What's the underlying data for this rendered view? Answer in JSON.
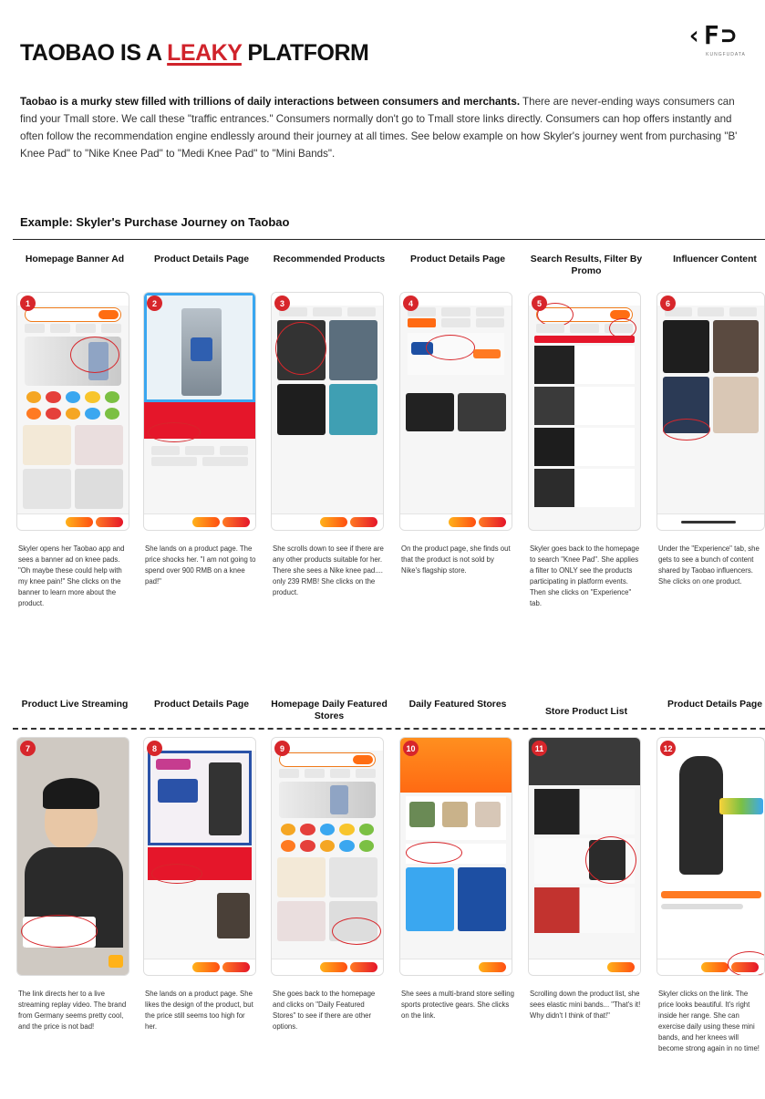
{
  "header": {
    "title_prefix": "TAOBAO IS A ",
    "title_highlight": "LEAKY",
    "title_suffix": " PLATFORM",
    "logo_mark": "‹F⊃",
    "logo_tag": "KUNGFUDATA"
  },
  "intro": {
    "bold": "Taobao is a murky stew filled with trillions of daily interactions between consumers and merchants.",
    "rest": " There are never-ending ways consumers can find your Tmall store. We call these \"traffic entrances.\" Consumers normally don't go to Tmall store links directly. Consumers can hop offers instantly and often follow the recommendation engine endlessly around their journey at all times. See below example on how Skyler's journey went from purchasing \"B' Knee Pad\" to \"Nike Knee Pad\" to \"Medi Knee Pad\" to \"Mini Bands\"."
  },
  "section_heading": "Example: Skyler's Purchase Journey on Taobao",
  "steps": [
    {
      "num": "1",
      "title": "Homepage Banner Ad",
      "caption": "Skyler opens her Taobao app and sees a banner ad on knee pads. \"Oh maybe these could help with my knee pain!\" She clicks on the banner to learn more about the product."
    },
    {
      "num": "2",
      "title": "Product Details Page",
      "caption": "She lands on a product page. The price shocks her. \"I am not going to spend over 900 RMB on a knee pad!\""
    },
    {
      "num": "3",
      "title": "Recommended Products",
      "caption": "She scrolls down to see if there are any other products suitable for her. There she sees a Nike knee pad.... only 239 RMB! She clicks on the product."
    },
    {
      "num": "4",
      "title": "Product Details Page",
      "caption": "On the product page, she finds out that the product is not sold by Nike's flagship store."
    },
    {
      "num": "5",
      "title": "Search Results, Filter By Promo",
      "caption": "Skyler goes back to the homepage to search \"Knee Pad\". She applies a filter to ONLY see the products participating in platform events. Then she clicks on \"Experience\" tab."
    },
    {
      "num": "6",
      "title": "Influencer Content",
      "caption": "Under the \"Experience\" tab, she gets to see a bunch of content shared by Taobao influencers. She clicks on one product."
    },
    {
      "num": "7",
      "title": "Product Live Streaming",
      "caption": "The link directs her to a live streaming replay video. The brand from Germany seems pretty cool, and the price is not bad!"
    },
    {
      "num": "8",
      "title": "Product Details Page",
      "caption": "She lands on a product page. She likes the design of the product, but the price still seems too high for her."
    },
    {
      "num": "9",
      "title": "Homepage Daily Featured Stores",
      "caption": "She goes back to the homepage and clicks on \"Daily Featured Stores\" to see if there are other options."
    },
    {
      "num": "10",
      "title": "Daily Featured Stores",
      "caption": "She sees a multi-brand store selling sports protective gears. She clicks on the link."
    },
    {
      "num": "11",
      "title": "Store Product List",
      "caption": "Scrolling down the product list, she sees elastic mini bands... \"That's it! Why didn't I think of that!\""
    },
    {
      "num": "12",
      "title": "Product Details Page",
      "caption": "Skyler clicks on the link. The price looks beautiful. It's right inside her range. She can exercise daily using these mini bands, and her knees will become strong again in no time!"
    }
  ],
  "colors": {
    "accent_red": "#d0232b",
    "taobao_orange": "#ff6a13",
    "text": "#222222"
  }
}
